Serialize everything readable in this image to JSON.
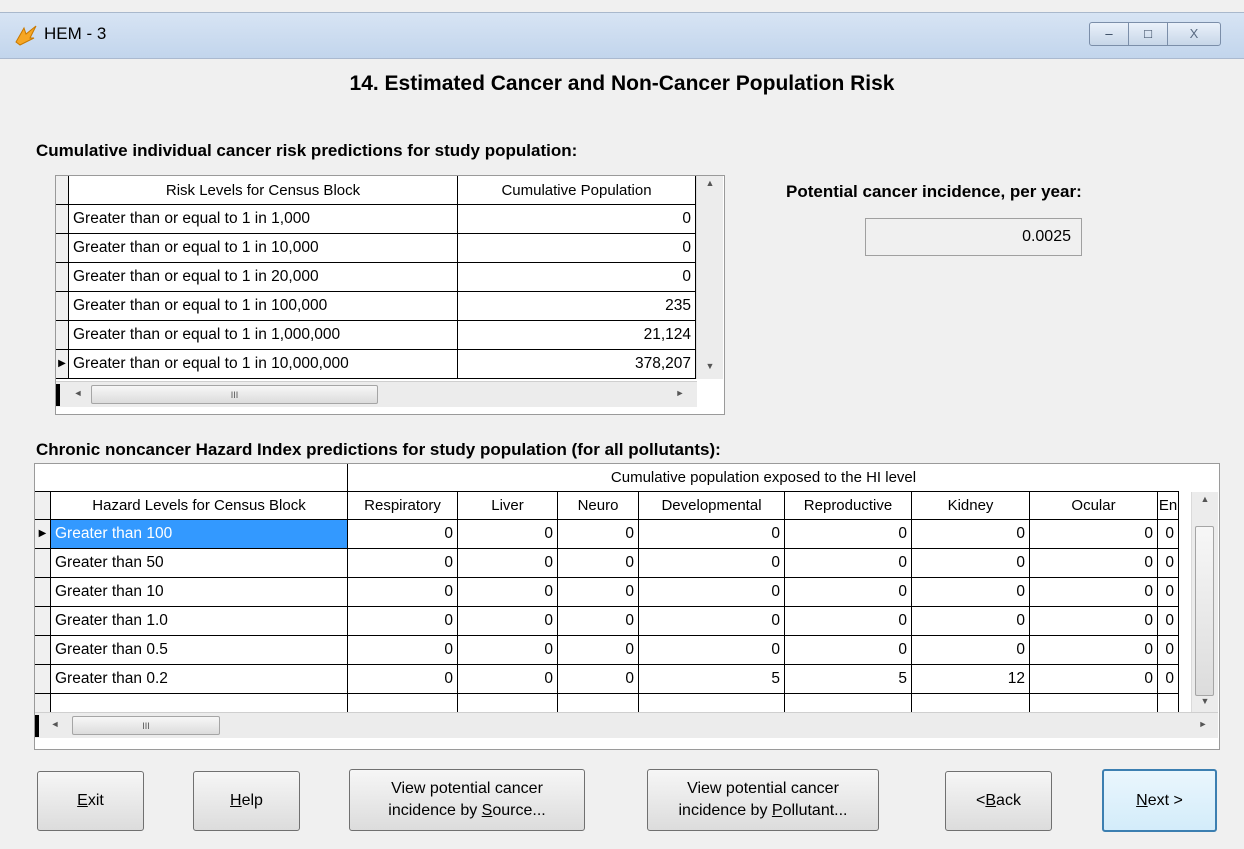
{
  "window": {
    "title": "HEM - 3",
    "controls": {
      "minimize": "–",
      "maximize": "□",
      "close": "X"
    }
  },
  "heading": "14. Estimated Cancer and Non-Cancer Population Risk",
  "cancer_section": {
    "title": "Cumulative individual cancer risk predictions for study population:",
    "columns": [
      "Risk Levels for Census Block",
      "Cumulative Population"
    ],
    "rows": [
      {
        "level": "Greater than or equal to 1 in 1,000",
        "population": "0"
      },
      {
        "level": "Greater than or equal to 1 in 10,000",
        "population": "0"
      },
      {
        "level": "Greater than or equal to 1 in 20,000",
        "population": "0"
      },
      {
        "level": "Greater than or equal to 1 in 100,000",
        "population": "235"
      },
      {
        "level": "Greater than or equal to 1 in 1,000,000",
        "population": "21,124"
      },
      {
        "level": "Greater than or equal to 1 in 10,000,000",
        "population": "378,207"
      }
    ],
    "current_row_marker": "▶",
    "scroll_thumb_grip": "III"
  },
  "incidence": {
    "label": "Potential cancer incidence, per year:",
    "value": "0.0025"
  },
  "hazard_section": {
    "title": "Chronic noncancer Hazard Index predictions for study population (for all pollutants):",
    "group_header": "Cumulative population exposed to the HI level",
    "columns": [
      "Hazard Levels for Census Block",
      "Respiratory",
      "Liver",
      "Neuro",
      "Developmental",
      "Reproductive",
      "Kidney",
      "Ocular",
      "En"
    ],
    "rows": [
      {
        "level": "Greater than 100",
        "values": [
          "0",
          "0",
          "0",
          "0",
          "0",
          "0",
          "0",
          "0"
        ]
      },
      {
        "level": "Greater than 50",
        "values": [
          "0",
          "0",
          "0",
          "0",
          "0",
          "0",
          "0",
          "0"
        ]
      },
      {
        "level": "Greater than 10",
        "values": [
          "0",
          "0",
          "0",
          "0",
          "0",
          "0",
          "0",
          "0"
        ]
      },
      {
        "level": "Greater than 1.0",
        "values": [
          "0",
          "0",
          "0",
          "0",
          "0",
          "0",
          "0",
          "0"
        ]
      },
      {
        "level": "Greater than 0.5",
        "values": [
          "0",
          "0",
          "0",
          "0",
          "0",
          "0",
          "0",
          "0"
        ]
      },
      {
        "level": "Greater than 0.2",
        "values": [
          "0",
          "0",
          "0",
          "5",
          "5",
          "12",
          "0",
          "0"
        ]
      }
    ],
    "selected_row": 0,
    "current_row_marker": "▶",
    "scroll_thumb_grip": "III"
  },
  "buttons": {
    "exit": {
      "pre": "",
      "key": "E",
      "post": "xit"
    },
    "help": {
      "pre": "",
      "key": "H",
      "post": "elp"
    },
    "by_source": {
      "line1": "View potential cancer",
      "line2_pre": "incidence by ",
      "key": "S",
      "line2_post": "ource..."
    },
    "by_pollutant": {
      "line1": "View potential cancer",
      "line2_pre": "incidence by ",
      "key": "P",
      "line2_post": "ollutant..."
    },
    "back": {
      "pre": "< ",
      "key": "B",
      "post": "ack"
    },
    "next": {
      "pre": "",
      "key": "N",
      "post": "ext >"
    }
  }
}
